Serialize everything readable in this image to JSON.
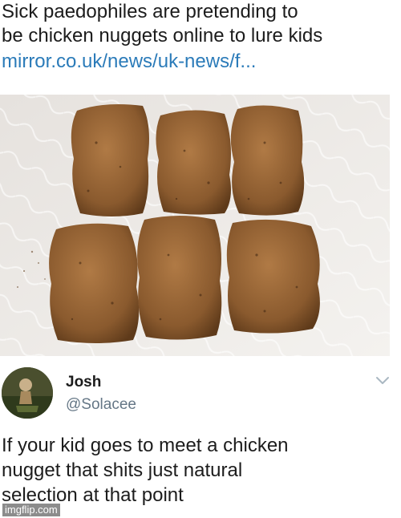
{
  "headline": "Sick paedophiles are pretending to\nbe chicken nuggets online to lure kids",
  "link": "mirror.co.uk/news/uk-news/f...",
  "photo": {
    "subject": "six chicken nuggets on a paper towel"
  },
  "tweet": {
    "display_name": "Josh",
    "handle": "@Solacee",
    "menu_icon": "chevron-down-icon",
    "text": "If your kid goes to meet a chicken\nnugget that shits just natural\nselection at that point"
  },
  "watermark": "imgflip.com",
  "colors": {
    "link": "#2b7bb9",
    "handle": "#657786",
    "text": "#1c1c1c"
  }
}
